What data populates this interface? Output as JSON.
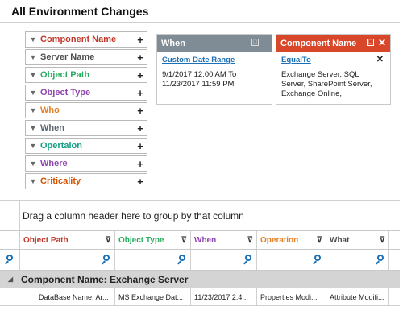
{
  "page": {
    "title": "All Environment Changes"
  },
  "filters": [
    {
      "label": "Component Name",
      "color": "#c0392b"
    },
    {
      "label": "Server Name",
      "color": "#4d4d4d"
    },
    {
      "label": "Object Path",
      "color": "#27ae60"
    },
    {
      "label": "Object Type",
      "color": "#8e44ad"
    },
    {
      "label": "Who",
      "color": "#e67e22"
    },
    {
      "label": "When",
      "color": "#5a6570"
    },
    {
      "label": "Opertaion",
      "color": "#16a085"
    },
    {
      "label": "Where",
      "color": "#8e44ad"
    },
    {
      "label": "Criticality",
      "color": "#d35400"
    }
  ],
  "when_card": {
    "title": "When",
    "link": "Custom Date Range",
    "text": "9/1/2017 12:00 AM To 11/23/2017 11:59 PM",
    "header_color": "#7f8c95"
  },
  "component_card": {
    "title": "Component Name",
    "link": "EqualTo",
    "text": "Exchange Server, SQL Server, SharePoint Server, Exchange Online,",
    "header_color": "#d9472b"
  },
  "grid": {
    "group_hint": "Drag a column header here to group by that column",
    "columns": [
      {
        "label": "Object Path",
        "color": "#c0392b"
      },
      {
        "label": "Object Type",
        "color": "#27ae60"
      },
      {
        "label": "When",
        "color": "#8e44ad"
      },
      {
        "label": "Operation",
        "color": "#e67e22"
      },
      {
        "label": "What",
        "color": "#4d4d4d"
      }
    ],
    "group_label": "Component Name: Exchange Server",
    "row": [
      "DataBase Name: Ar...",
      "MS Exchange Dat...",
      "11/23/2017 2:4...",
      "Properties Modi...",
      "Attribute Modifi..."
    ]
  }
}
